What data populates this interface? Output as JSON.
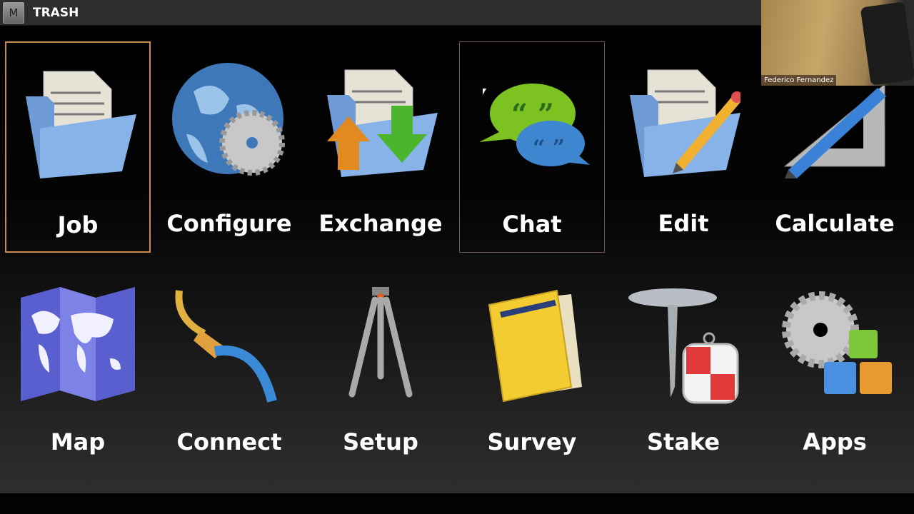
{
  "titlebar": {
    "logo": "M",
    "title": "TRASH"
  },
  "video": {
    "participant": "Federico Fernandez"
  },
  "tiles": [
    {
      "label": "Job",
      "icon": "folder-document-icon",
      "state": "selected"
    },
    {
      "label": "Configure",
      "icon": "globe-gear-icon"
    },
    {
      "label": "Exchange",
      "icon": "folder-exchange-icon"
    },
    {
      "label": "Chat",
      "icon": "chat-bubbles-icon",
      "state": "hover"
    },
    {
      "label": "Edit",
      "icon": "folder-pencil-icon"
    },
    {
      "label": "Calculate",
      "icon": "pencil-square-icon"
    },
    {
      "label": "Map",
      "icon": "world-map-icon"
    },
    {
      "label": "Connect",
      "icon": "cable-icon"
    },
    {
      "label": "Setup",
      "icon": "tripod-icon"
    },
    {
      "label": "Survey",
      "icon": "notebook-icon"
    },
    {
      "label": "Stake",
      "icon": "stake-target-icon"
    },
    {
      "label": "Apps",
      "icon": "gear-blocks-icon"
    }
  ],
  "colors": {
    "selected_border": "#c88a4e",
    "hover_border": "#6b5a50"
  }
}
